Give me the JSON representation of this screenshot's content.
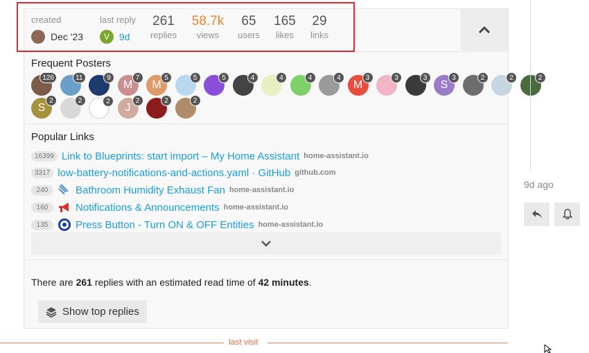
{
  "header": {
    "created": {
      "label": "created",
      "value": "Dec '23"
    },
    "last_reply": {
      "label": "last reply",
      "value": "9d",
      "avatar_letter": "V"
    },
    "stats": [
      {
        "num": "261",
        "label": "replies"
      },
      {
        "num": "58.7k",
        "label": "views"
      },
      {
        "num": "65",
        "label": "users"
      },
      {
        "num": "165",
        "label": "likes"
      },
      {
        "num": "29",
        "label": "links"
      }
    ]
  },
  "frequent_posters": {
    "title": "Frequent Posters",
    "items": [
      {
        "letter": "",
        "color": "#7a5c48",
        "count": "126"
      },
      {
        "letter": "",
        "color": "#6aa0c8",
        "count": "11"
      },
      {
        "letter": "",
        "color": "#1d3b6e",
        "count": "9"
      },
      {
        "letter": "M",
        "color": "#cc8f8f",
        "count": "7"
      },
      {
        "letter": "M",
        "color": "#e09a6a",
        "count": "5"
      },
      {
        "letter": "",
        "color": "#b8d8f0",
        "count": "5"
      },
      {
        "letter": "",
        "color": "#8a4fd8",
        "count": "5"
      },
      {
        "letter": "",
        "color": "#444444",
        "count": "4"
      },
      {
        "letter": "",
        "color": "#e9efc2",
        "count": "4"
      },
      {
        "letter": "",
        "color": "#7fd06a",
        "count": "4"
      },
      {
        "letter": "",
        "color": "#9a9a9a",
        "count": "4"
      },
      {
        "letter": "M",
        "color": "#e74c3c",
        "count": "3"
      },
      {
        "letter": "",
        "color": "#f2b5c8",
        "count": "3"
      },
      {
        "letter": "",
        "color": "#3a3a3a",
        "count": "3"
      },
      {
        "letter": "S",
        "color": "#9b7cc7",
        "count": "3"
      },
      {
        "letter": "",
        "color": "#6d6d6d",
        "count": "2"
      },
      {
        "letter": "",
        "color": "#c7d6e2",
        "count": "2"
      },
      {
        "letter": "",
        "color": "#4b6a3c",
        "count": "2"
      },
      {
        "letter": "S",
        "color": "#a5923a",
        "count": "2"
      },
      {
        "letter": "",
        "color": "#d8d8d8",
        "count": "2"
      },
      {
        "letter": "",
        "color": "#ffffff",
        "count": "2"
      },
      {
        "letter": "J",
        "color": "#d1ab9f",
        "count": "2"
      },
      {
        "letter": "",
        "color": "#8c1c1c",
        "count": "2"
      },
      {
        "letter": "",
        "color": "#b08b6a",
        "count": "2"
      }
    ]
  },
  "popular_links": {
    "title": "Popular Links",
    "items": [
      {
        "clicks": "16399",
        "title": "Link to Blueprints: start import – My Home Assistant",
        "domain": "home-assistant.io",
        "favicon": ""
      },
      {
        "clicks": "3317",
        "title": "low-battery-notifications-and-actions.yaml · GitHub",
        "domain": "github.com",
        "favicon": ""
      },
      {
        "clicks": "240",
        "title": "Bathroom Humidity Exhaust Fan",
        "domain": "home-assistant.io",
        "favicon": "fan-icon"
      },
      {
        "clicks": "160",
        "title": "Notifications & Announcements",
        "domain": "home-assistant.io",
        "favicon": "megaphone-icon"
      },
      {
        "clicks": "135",
        "title": "Press Button - Turn ON & OFF Entities",
        "domain": "home-assistant.io",
        "favicon": "target-icon"
      }
    ]
  },
  "summary": {
    "prefix": "There are ",
    "replies": "261",
    "middle": " replies with an estimated read time of ",
    "read_time": "42 minutes",
    "suffix": "."
  },
  "show_top_replies": {
    "label": "Show top replies"
  },
  "last_visit": {
    "label": "last visit"
  },
  "timeline": {
    "date": "9d ago"
  },
  "colors": {
    "accent": "#1a9ed8",
    "hot_views": "#f0832c",
    "highlight": "#e0252f",
    "last_visit": "#e06c42"
  }
}
